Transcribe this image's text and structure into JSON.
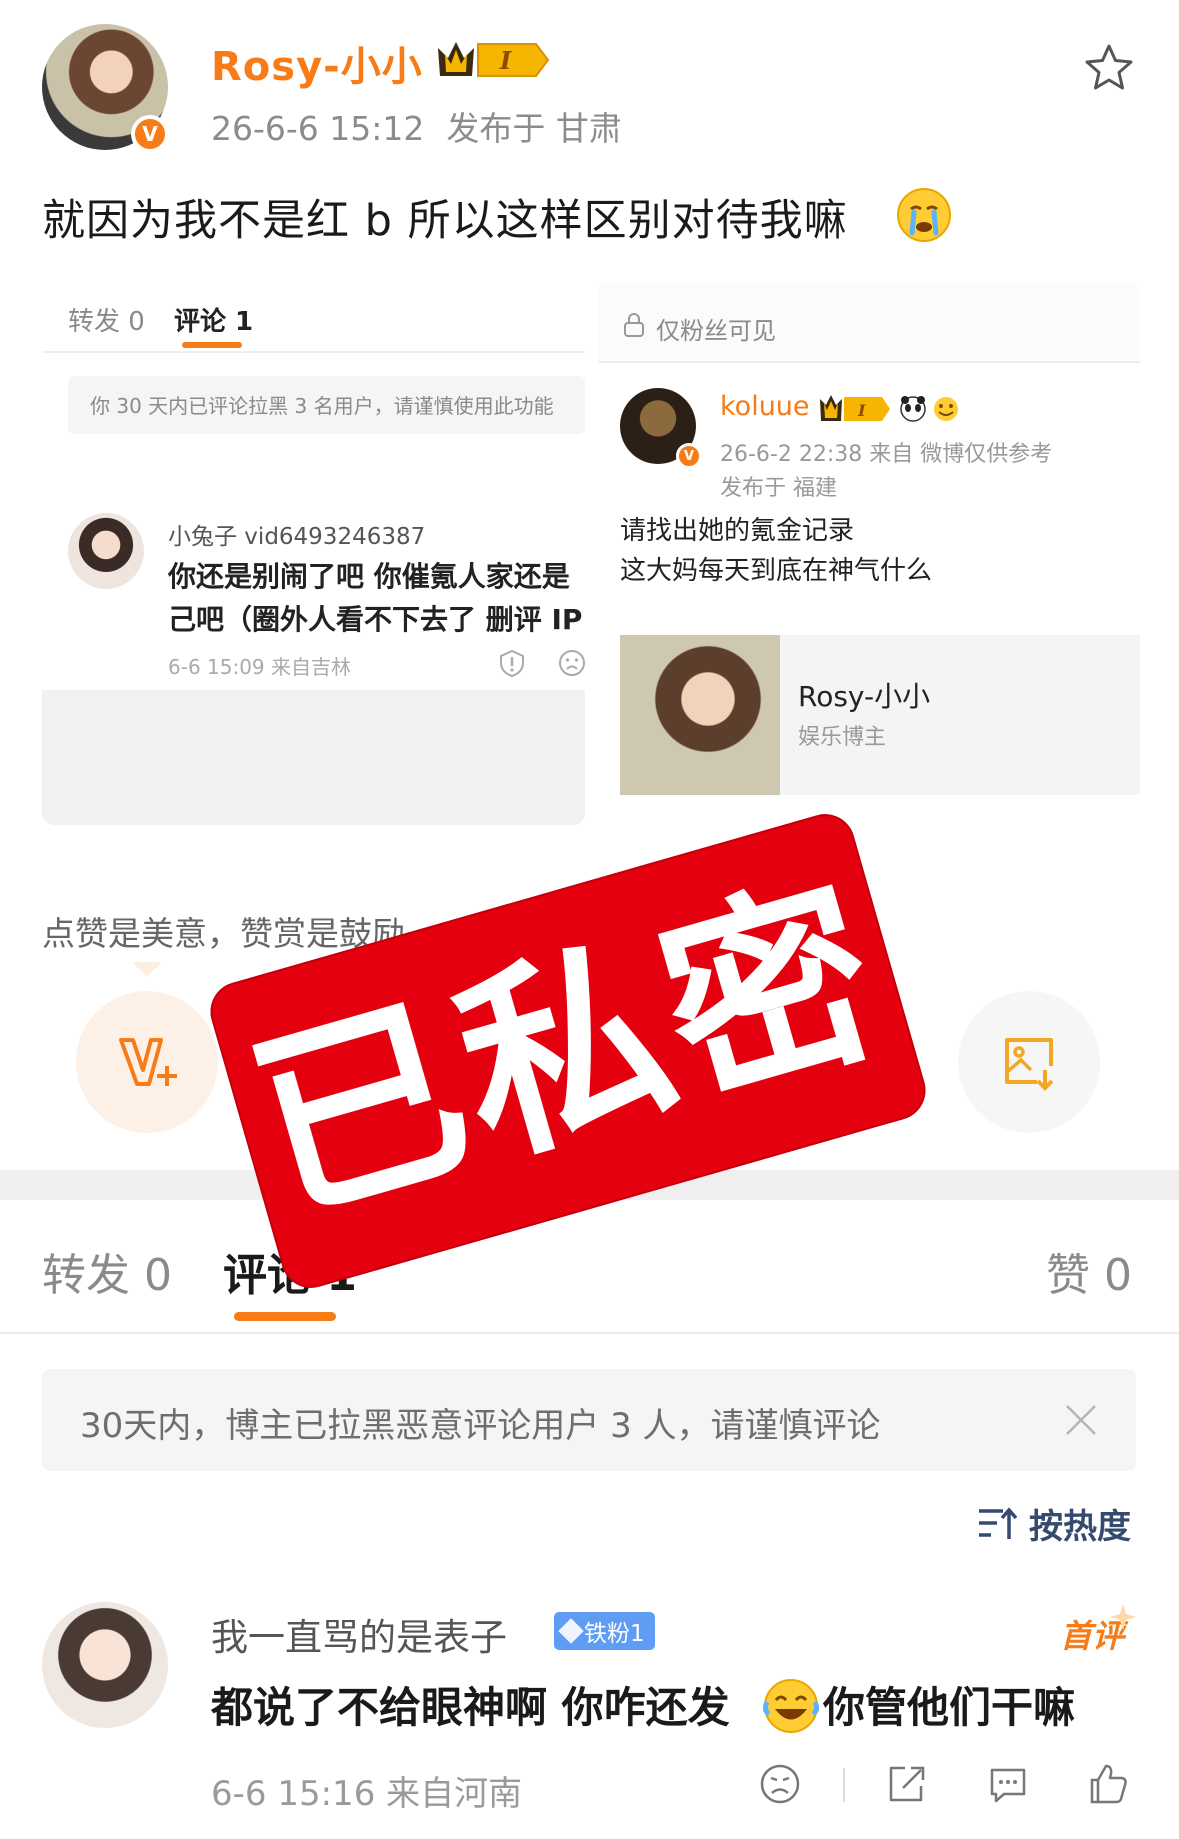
{
  "post": {
    "username": "Rosy-小小",
    "badge_level": "I",
    "time": "26-6-6 15:12",
    "location": "发布于 甘肃",
    "text": "就因为我不是红 b 所以这样区别对待我嘛"
  },
  "left_screenshot": {
    "tabs": [
      {
        "label": "转发 0"
      },
      {
        "label": "评论 1"
      }
    ],
    "notice": "你 30 天内已评论拉黑 3 名用户，请谨慎使用此功能",
    "comment": {
      "name": "小兔子 vid6493246387",
      "line1": "你还是别闹了吧  你催氪人家还是",
      "line2": "己吧（圈外人看不下去了  删评 IP",
      "meta": "6-6 15:09  来自吉林"
    }
  },
  "right_screenshot": {
    "visibility": "仅粉丝可见",
    "name": "koluue",
    "badge_level": "I",
    "meta": "26-6-2 22:38  来自 微博仅供参考",
    "location": "发布于 福建",
    "line1": "请找出她的氪金记录",
    "line2": "这大妈每天到底在神气什么",
    "card": {
      "name": "Rosy-小小",
      "role": "娱乐博主"
    }
  },
  "reward": {
    "text": "点赞是美意，赞赏是鼓励"
  },
  "stamp": {
    "text": "已私密"
  },
  "tabs": {
    "repost": "转发 0",
    "comment": "评论 1",
    "like": "赞 0"
  },
  "notice": {
    "text": "30天内，博主已拉黑恶意评论用户 3 人，请谨慎评论"
  },
  "sort": {
    "label": "按热度"
  },
  "comment": {
    "name": "我一直骂的是表子",
    "fan_badge": "铁粉1",
    "first_badge": "首评",
    "text_before": "都说了不给眼神啊 你咋还发",
    "text_after": "你管他们干嘛",
    "meta": "6-6 15:16 来自河南"
  },
  "colors": {
    "accent": "#f77b17",
    "stamp": "#e5000f",
    "fan_badge": "#5f9cf4",
    "sort": "#364a6f"
  }
}
